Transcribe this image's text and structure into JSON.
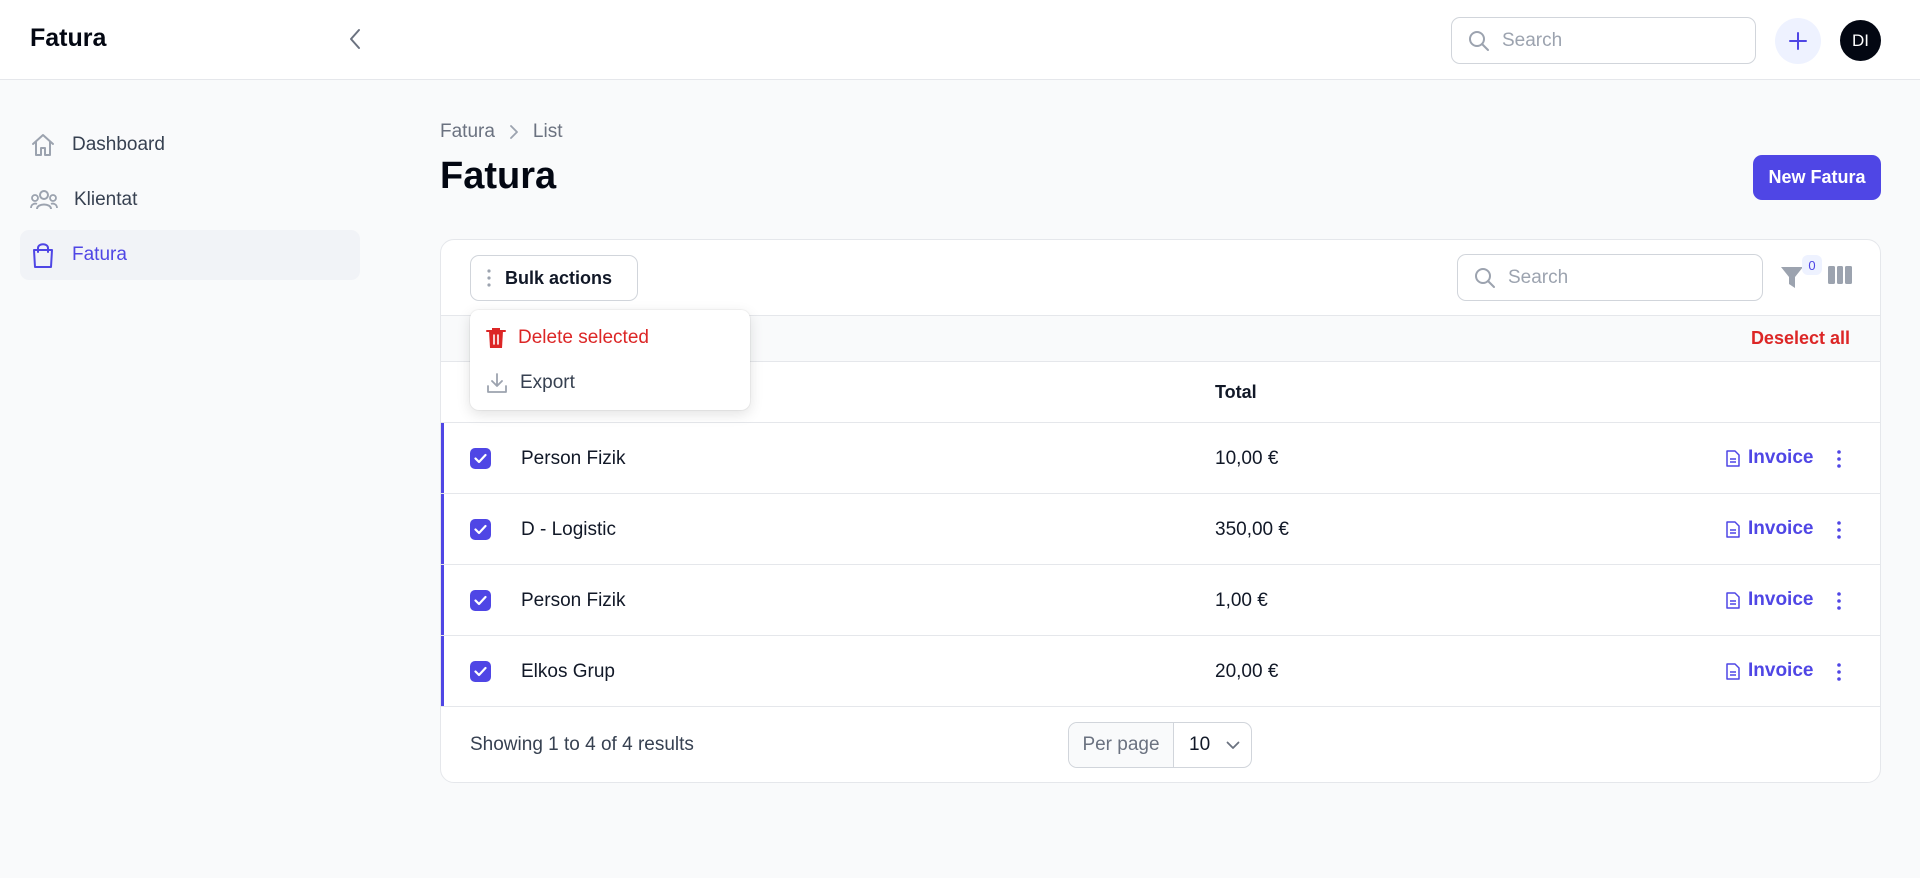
{
  "app": {
    "brand": "Fatura"
  },
  "header": {
    "search_placeholder": "Search",
    "avatar_initials": "DI"
  },
  "sidebar": {
    "items": [
      {
        "label": "Dashboard",
        "icon": "home-icon"
      },
      {
        "label": "Klientat",
        "icon": "users-icon"
      },
      {
        "label": "Fatura",
        "icon": "shopping-bag-icon",
        "active": true
      }
    ]
  },
  "breadcrumb": [
    "Fatura",
    "List"
  ],
  "page": {
    "title": "Fatura",
    "new_button": "New Fatura"
  },
  "table": {
    "bulk_actions_label": "Bulk actions",
    "search_placeholder": "Search",
    "filter_count": "0",
    "deselect_all": "Deselect all",
    "columns": {
      "total": "Total"
    },
    "rows": [
      {
        "name": "Person Fizik",
        "total": "10,00 €",
        "action": "Invoice",
        "selected": true
      },
      {
        "name": "D - Logistic",
        "total": "350,00 €",
        "action": "Invoice",
        "selected": true
      },
      {
        "name": "Person Fizik",
        "total": "1,00 €",
        "action": "Invoice",
        "selected": true
      },
      {
        "name": "Elkos Grup",
        "total": "20,00 €",
        "action": "Invoice",
        "selected": true
      }
    ],
    "footer": {
      "results_text": "Showing 1 to 4 of 4 results",
      "per_page_label": "Per page",
      "per_page_value": "10"
    }
  },
  "bulk_menu": {
    "items": [
      {
        "label": "Delete selected",
        "icon": "trash-icon"
      },
      {
        "label": "Export",
        "icon": "download-icon"
      }
    ]
  },
  "colors": {
    "primary": "#4f46e5",
    "danger": "#dc2626",
    "background": "#f9fafb"
  }
}
